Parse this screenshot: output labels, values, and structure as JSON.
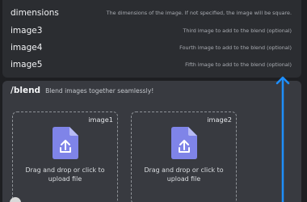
{
  "options": [
    {
      "name": "dimensions",
      "description": "The dimensions of the image. If not specified, the image will be square."
    },
    {
      "name": "image3",
      "description": "Third image to add to the blend (optional)"
    },
    {
      "name": "image4",
      "description": "Fourth image to add to the blend (optional)"
    },
    {
      "name": "image5",
      "description": "Fifth image to add to the blend (optional)"
    }
  ],
  "command": {
    "name": "/blend",
    "description": "Blend images together seamlessly!"
  },
  "uploads": [
    {
      "label": "image1",
      "text": "Drag and drop or click to upload file"
    },
    {
      "label": "image2",
      "text": "Drag and drop or click to upload file"
    }
  ],
  "colors": {
    "background": "#1e1f22",
    "panel": "#2b2d31",
    "command_panel": "#383a40",
    "icon_purple": "#7f84e8",
    "arrow_blue": "#1e8fff"
  },
  "icons": [
    "upload-file-icon",
    "up-arrow-icon"
  ]
}
